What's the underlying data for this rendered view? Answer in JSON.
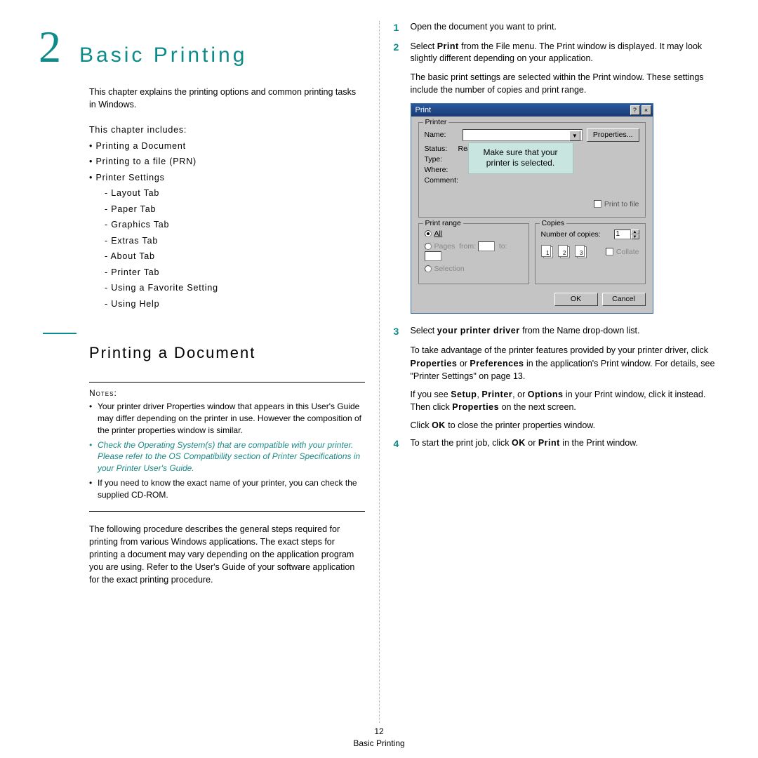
{
  "chapter": {
    "number": "2",
    "title": "Basic Printing"
  },
  "intro": "This chapter explains the printing options and common printing tasks in Windows.",
  "includes": "This chapter includes:",
  "toc": {
    "i0": "Printing a Document",
    "i1": "Printing to a file (PRN)",
    "i2": "Printer Settings",
    "s0": "Layout Tab",
    "s1": "Paper Tab",
    "s2": "Graphics Tab",
    "s3": "Extras Tab",
    "s4": "About Tab",
    "s5": "Printer Tab",
    "s6": "Using a Favorite Setting",
    "s7": "Using Help"
  },
  "section1": "Printing a Document",
  "notesLabel": "Notes:",
  "notes": {
    "n0": "Your printer driver Properties window that appears in this User's Guide may differ depending on the printer in use. However the composition of the printer properties window is similar.",
    "n1": "Check the Operating System(s) that are compatible with your printer. Please refer to the OS Compatibility section of Printer Specifications in your Printer User's Guide.",
    "n2": "If you need to know the exact name of your printer, you can check the supplied CD-ROM."
  },
  "body1": "The following procedure describes the general steps required for printing from various Windows applications. The exact steps for printing a document may vary depending on the application program you are using. Refer to the User's Guide of your software application for the exact printing procedure.",
  "steps": {
    "s1n": "1",
    "s1": "Open the document you want to print.",
    "s2n": "2",
    "s2a": "Select ",
    "s2b": "Print",
    "s2c": " from the File menu. The Print window is displayed. It may look slightly different depending on your application.",
    "s2p": "The basic print settings are selected within the Print window. These settings include the number of copies and print range.",
    "s3n": "3",
    "s3a": "Select ",
    "s3b": "your printer driver",
    "s3c": " from the Name drop-down list.",
    "s3p1a": "To take advantage of the printer features provided by your printer driver, click ",
    "s3p1b": "Properties",
    "s3p1c": " or ",
    "s3p1d": "Preferences",
    "s3p1e": " in the application's Print window. For details, see \"Printer Settings\" on page 13.",
    "s3p2a": "If you see ",
    "s3p2b": "Setup",
    "s3p2c": ", ",
    "s3p2d": "Printer",
    "s3p2e": ", or ",
    "s3p2f": "Options",
    "s3p2g": " in your Print window, click it instead. Then click ",
    "s3p2h": "Properties",
    "s3p2i": " on the next screen.",
    "s3p3a": "Click ",
    "s3p3b": "OK",
    "s3p3c": " to close the printer properties window.",
    "s4n": "4",
    "s4a": "To start the print job, click ",
    "s4b": "OK",
    "s4c": " or ",
    "s4d": "Print",
    "s4e": " in the Print window."
  },
  "dlg": {
    "title": "Print",
    "helpBtn": "?",
    "closeBtn": "×",
    "printerGroup": "Printer",
    "nameLbl": "Name:",
    "propsBtn": "Properties...",
    "statusLbl": "Status:",
    "statusVal": "Ready",
    "typeLbl": "Type:",
    "whereLbl": "Where:",
    "commentLbl": "Comment:",
    "printToFile": "Print to file",
    "callout": "Make sure that your printer is selected.",
    "rangeGroup": "Print range",
    "allLbl": "All",
    "pagesLbl": "Pages",
    "fromLbl": "from:",
    "toLbl": "to:",
    "selectionLbl": "Selection",
    "copiesGroup": "Copies",
    "numCopiesLbl": "Number of copies:",
    "numCopiesVal": "1",
    "collateLbl": "Collate",
    "okBtn": "OK",
    "cancelBtn": "Cancel",
    "p11": "1",
    "p12": "1",
    "p21": "2",
    "p22": "2",
    "p31": "3",
    "p32": "3"
  },
  "footer": {
    "page": "12",
    "title": "Basic Printing"
  }
}
